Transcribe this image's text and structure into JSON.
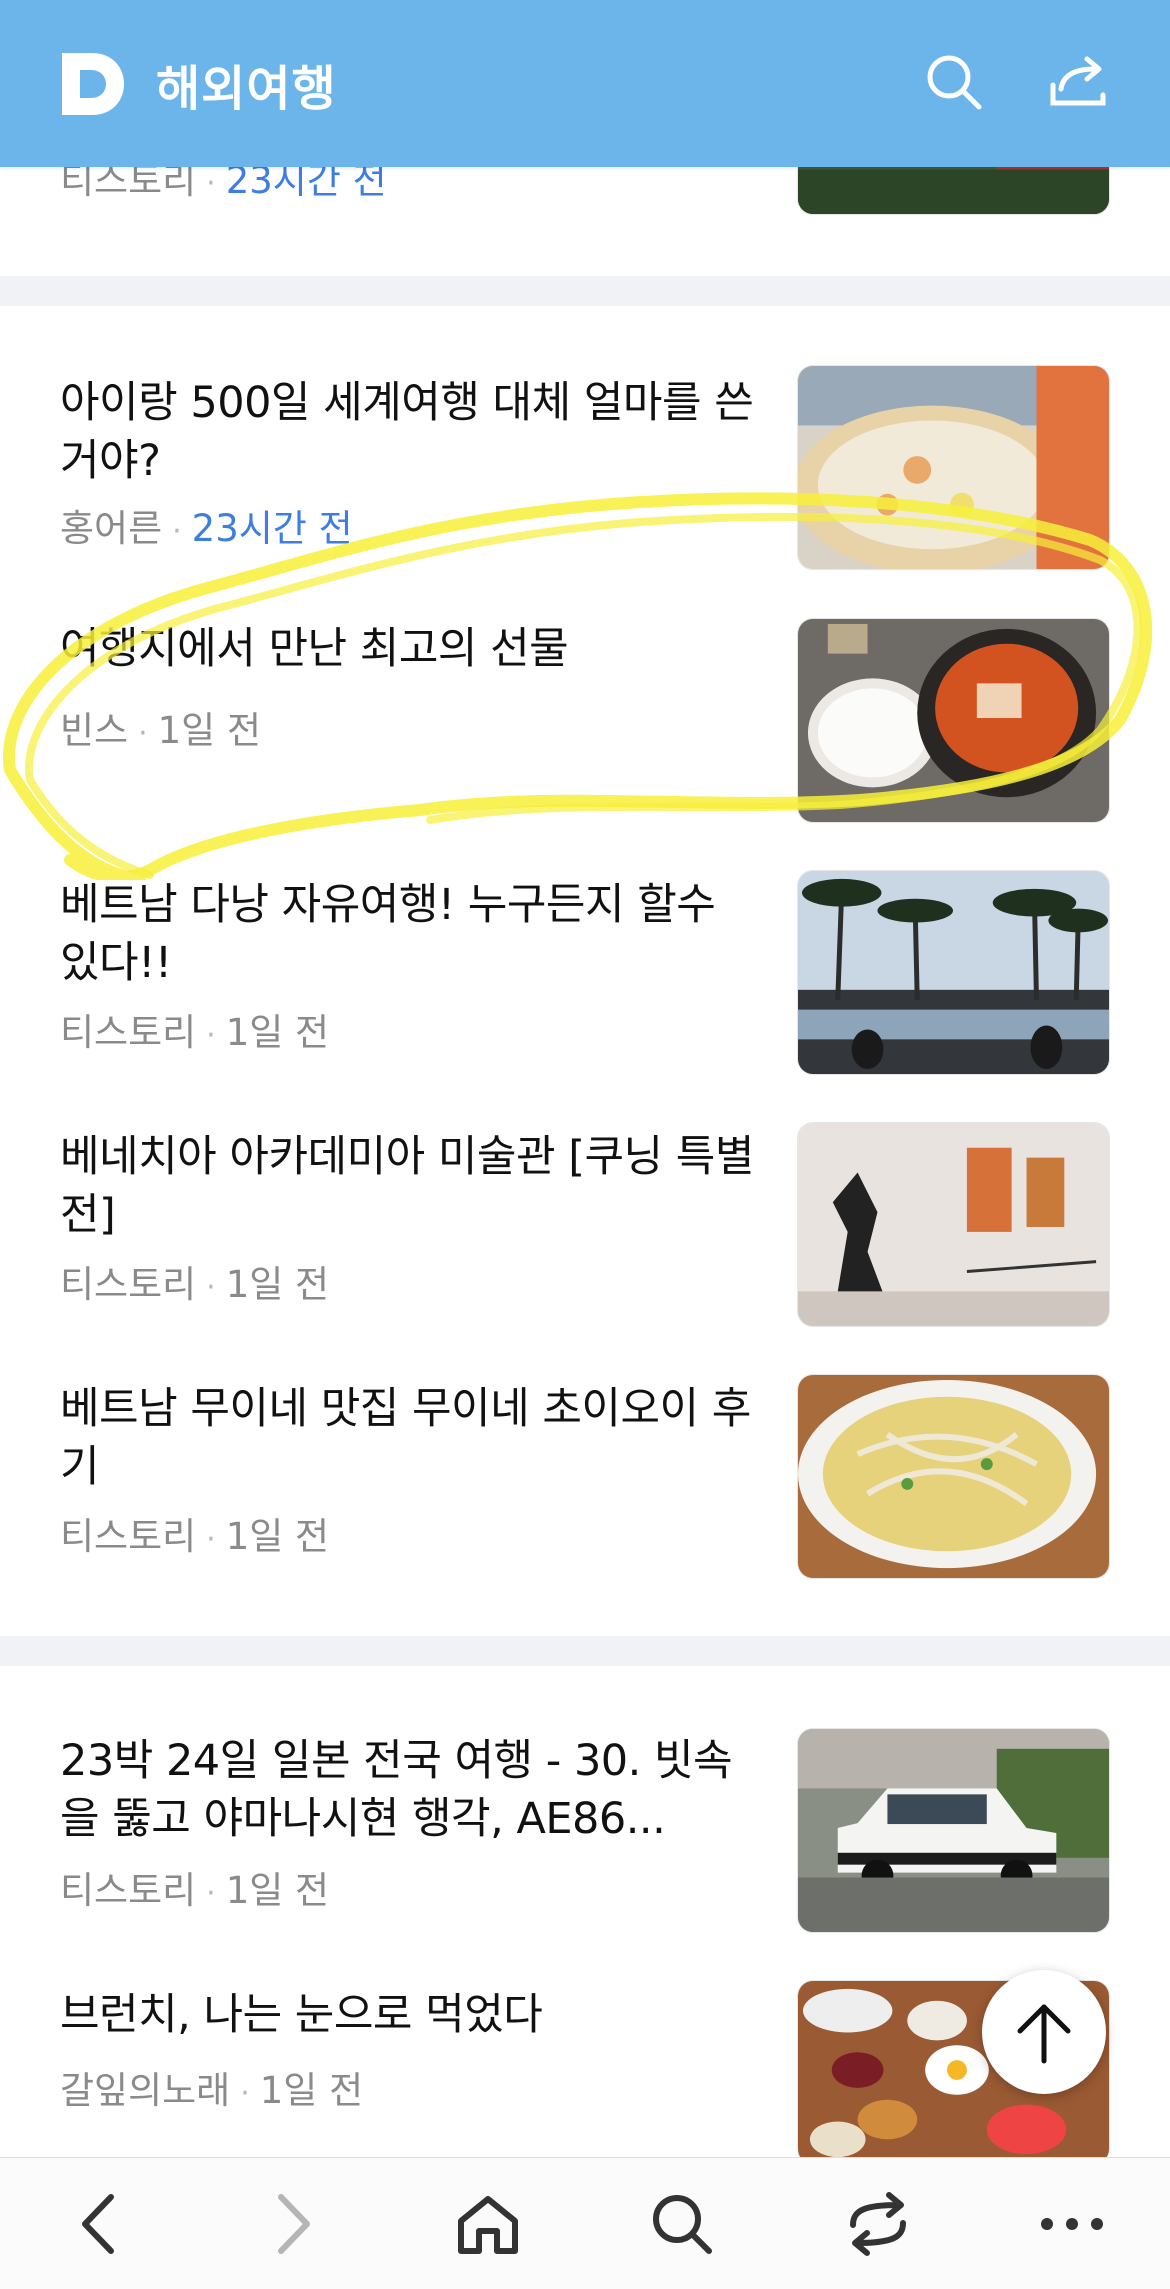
{
  "header": {
    "logo_letter": "D",
    "title": "해외여행",
    "search_icon": "search-icon",
    "share_icon": "share-icon",
    "bg_color": "#6bb5ea"
  },
  "partial_item": {
    "source": "티스토리",
    "time": "23시간 전"
  },
  "items": [
    {
      "title": "아이랑 500일 세계여행 대체 얼마를 쓴거야?",
      "source": "홍어른",
      "time": "23시간 전",
      "time_highlight": true
    },
    {
      "title": "여행지에서 만난 최고의 선물",
      "source": "빈스",
      "time": "1일 전"
    },
    {
      "title": "베트남 다낭 자유여행! 누구든지 할수 있다!!",
      "source": "티스토리",
      "time": "1일 전"
    },
    {
      "title": "베네치아 아카데미아 미술관 [쿠닝 특별전]",
      "source": "티스토리",
      "time": "1일 전"
    },
    {
      "title": "베트남 무이네 맛집 무이네 초이오이 후기",
      "source": "티스토리",
      "time": "1일 전"
    },
    {
      "title": "23박 24일 일본 전국 여행 - 30. 빗속을 뚫고 야마나시현 행각, AE86...",
      "source": "티스토리",
      "time": "1일 전"
    },
    {
      "title": "브런치, 나는 눈으로 먹었다",
      "source": "갈잎의노래",
      "time": "1일 전"
    }
  ],
  "meta_separator": "·",
  "colors": {
    "accent_blue": "#3d7ee0",
    "highlighter": "#f7f03a",
    "meta_gray": "#8a8a8a"
  },
  "bottom_bar": {
    "back_icon": "chevron-left-icon",
    "forward_icon": "chevron-right-icon",
    "home_icon": "home-icon",
    "search_icon": "search-icon",
    "share_icon": "share-icon",
    "more_icon": "more-icon"
  },
  "scroll_top_icon": "arrow-up-icon"
}
